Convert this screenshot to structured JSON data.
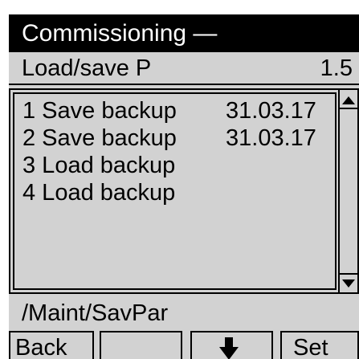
{
  "title": "Commissioning —",
  "subheader": {
    "label": "Load/save P",
    "number": "1.5"
  },
  "list": {
    "items": [
      {
        "label": "1 Save backup",
        "date": "31.03.17"
      },
      {
        "label": "2 Save backup",
        "date": "31.03.17"
      },
      {
        "label": "3 Load backup",
        "date": ""
      },
      {
        "label": "4 Load backup",
        "date": ""
      }
    ]
  },
  "path": "/Maint/SavPar",
  "softkeys": {
    "back": "Back",
    "key2": "",
    "key3_icon": "arrow-down-icon",
    "set": "Set"
  },
  "colors": {
    "title_bg": "#000000",
    "title_fg": "#ffffff",
    "screen_bg": "#d2d2d2"
  }
}
